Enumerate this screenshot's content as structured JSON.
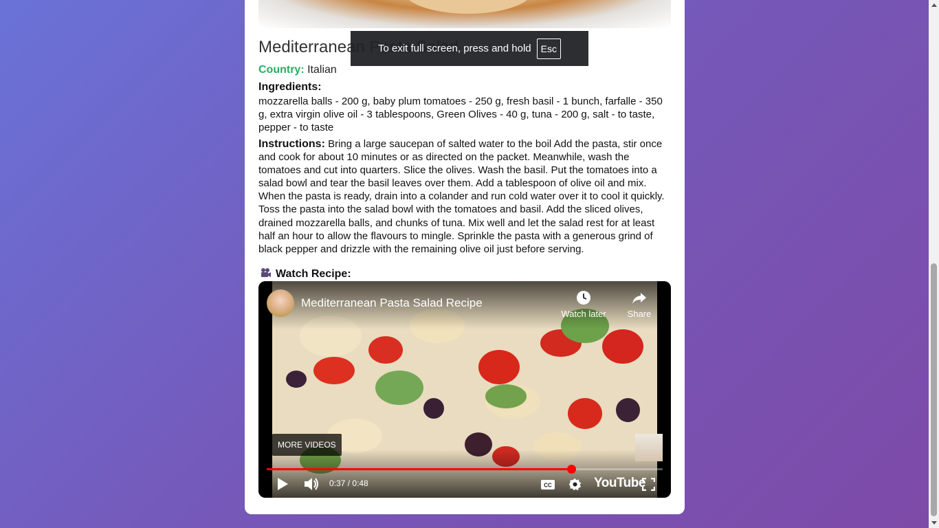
{
  "recipe": {
    "title": "Mediterranean Pasta Salad",
    "country_label": "Country:",
    "country": "Italian",
    "ingredients_label": "Ingredients:",
    "ingredients": "mozzarella balls - 200 g, baby plum tomatoes - 250 g, fresh basil - 1 bunch, farfalle - 350 g, extra virgin olive oil - 3 tablespoons, Green Olives - 40 g, tuna - 200 g, salt - to taste, pepper - to taste",
    "instructions_label": "Instructions:",
    "instructions": "Bring a large saucepan of salted water to the boil Add the pasta, stir once and cook for about 10 minutes or as directed on the packet. Meanwhile, wash the tomatoes and cut into quarters. Slice the olives. Wash the basil. Put the tomatoes into a salad bowl and tear the basil leaves over them. Add a tablespoon of olive oil and mix. When the pasta is ready, drain into a colander and run cold water over it to cool it quickly. Toss the pasta into the salad bowl with the tomatoes and basil. Add the sliced olives, drained mozzarella balls, and chunks of tuna. Mix well and let the salad rest for at least half an hour to allow the flavours to mingle. Sprinkle the pasta with a generous grind of black pepper and drizzle with the remaining olive oil just before serving.",
    "watch_label": "Watch Recipe:",
    "watch_icon": "video-camera-icon"
  },
  "video": {
    "title": "Mediterranean Pasta Salad Recipe",
    "watch_later": "Watch later",
    "share": "Share",
    "more_videos": "MORE VIDEOS",
    "time": "0:37 / 0:48",
    "progress": 0.77,
    "brand": "YouTube"
  },
  "toast": {
    "message": "To exit full screen, press and hold",
    "key": "Esc"
  },
  "colors": {
    "country_label": "#27ae60",
    "progress": "#ff0000"
  }
}
